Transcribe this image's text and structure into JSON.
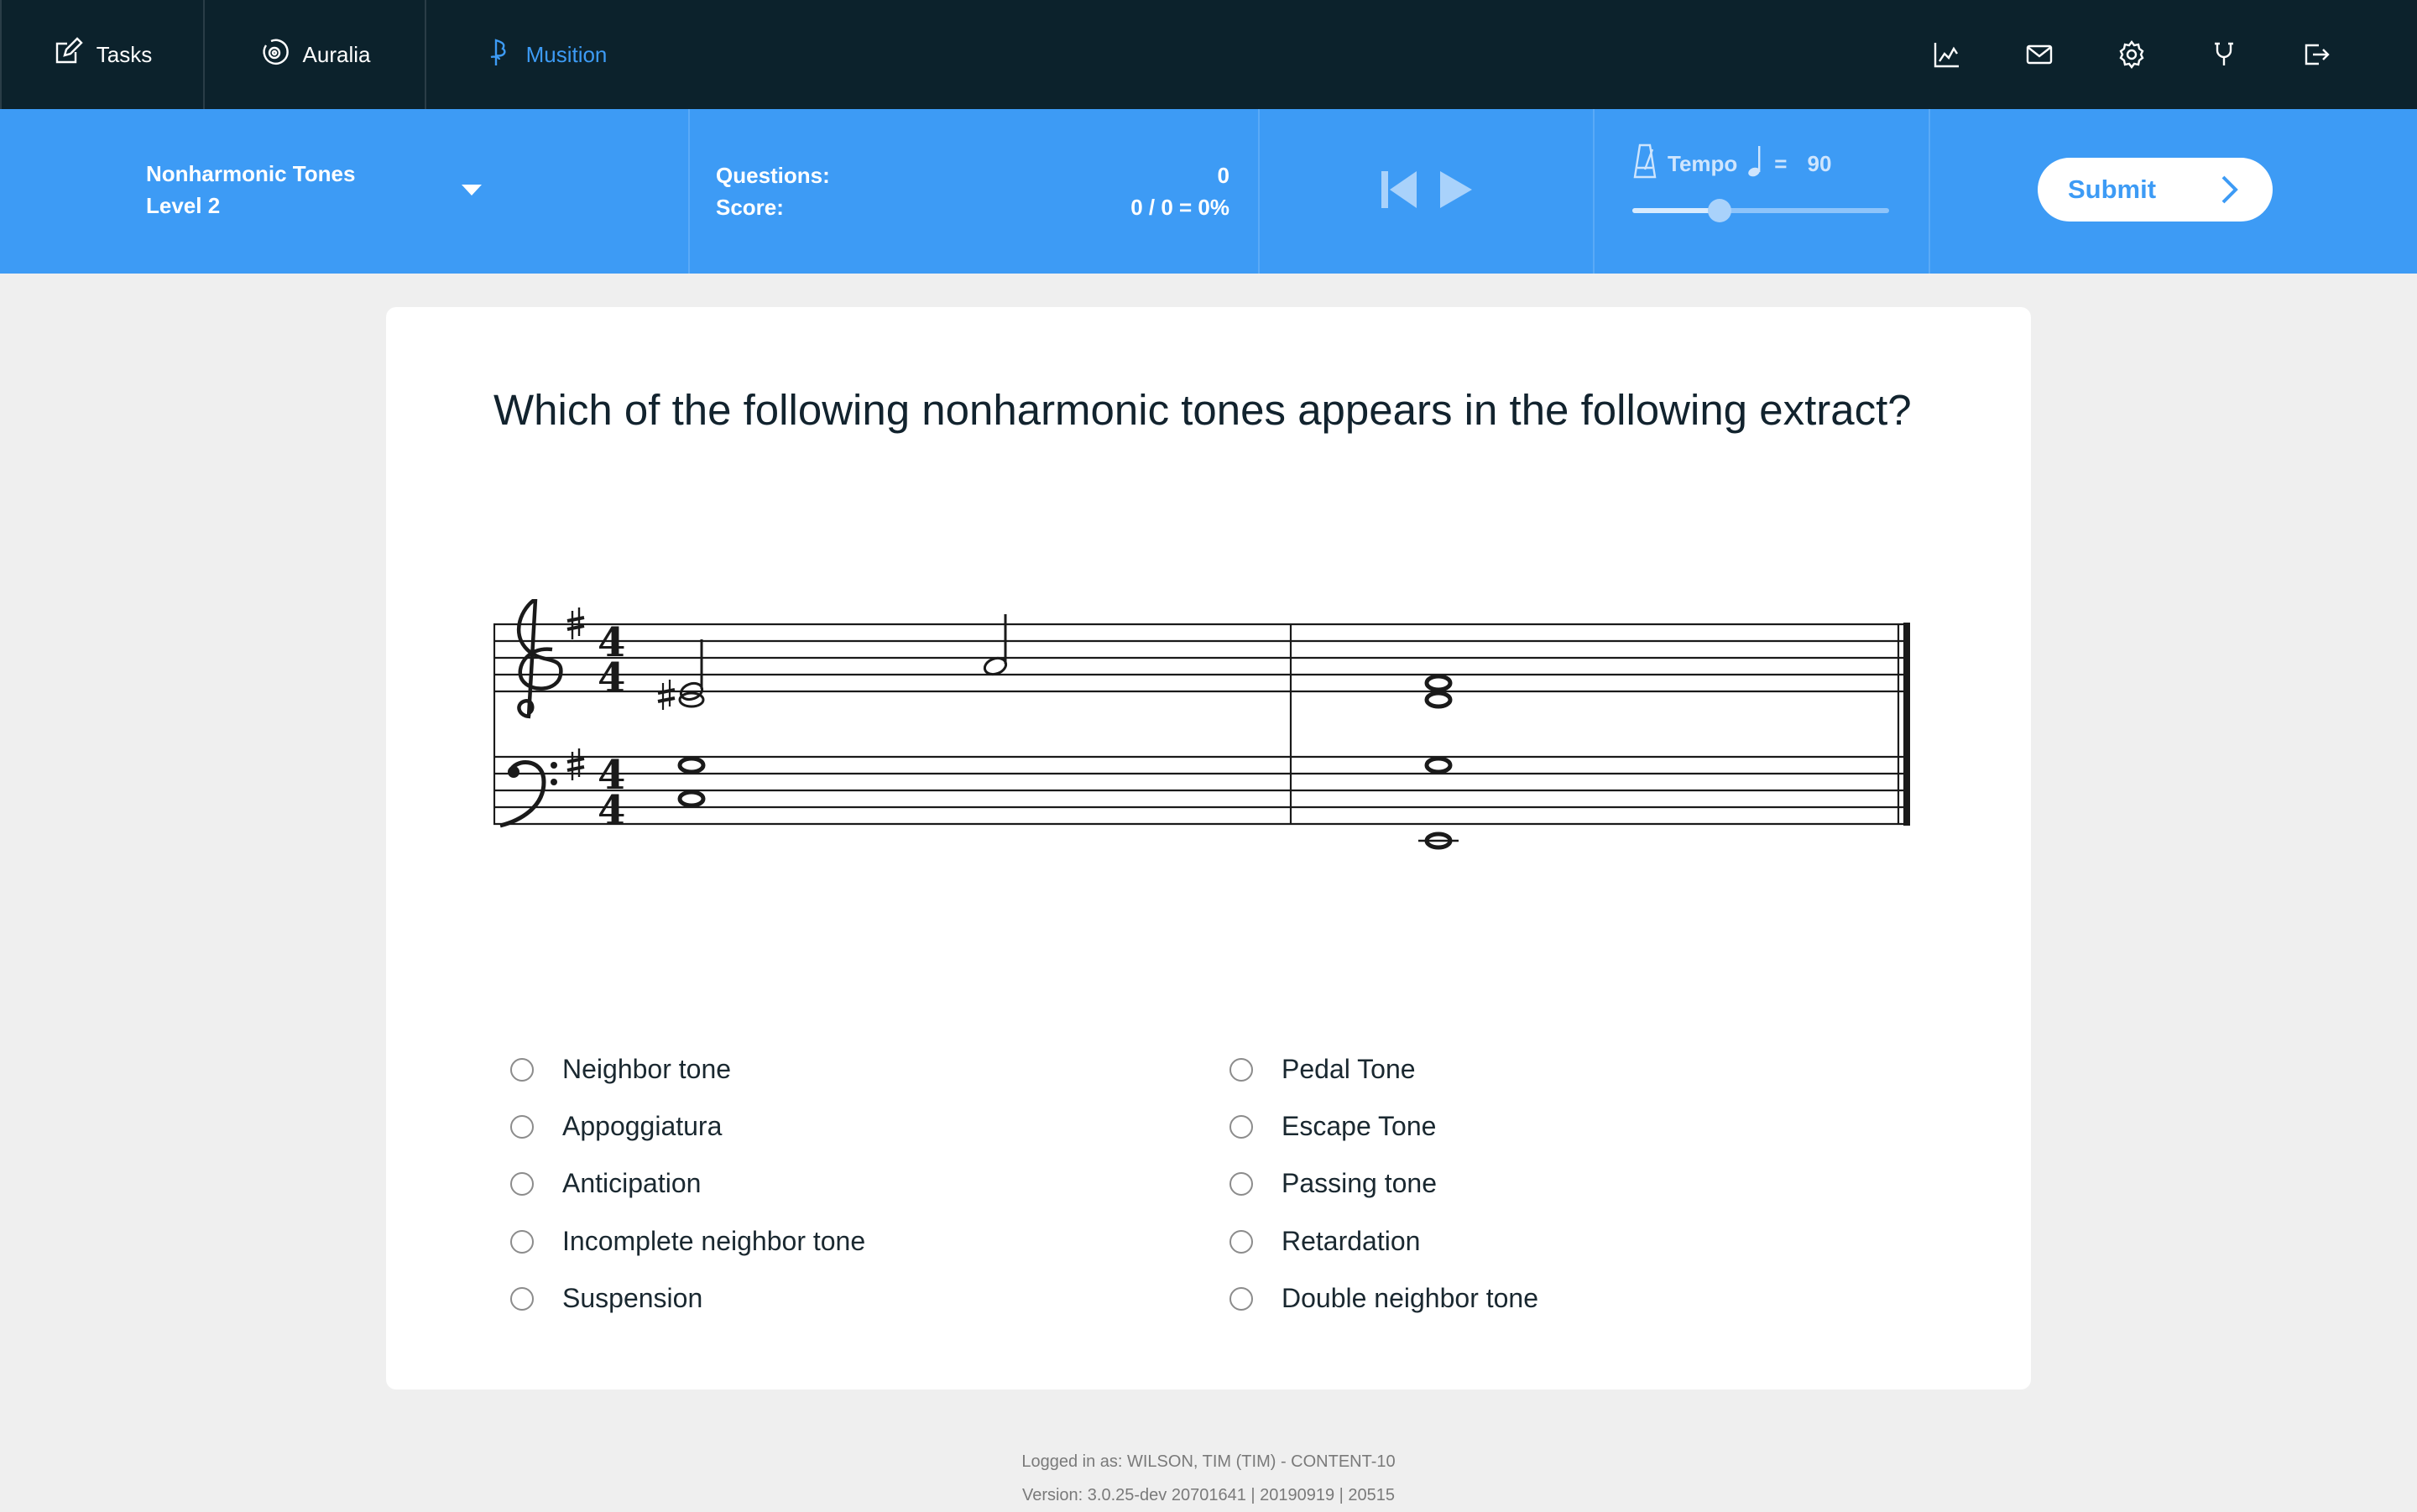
{
  "nav": {
    "tabs": [
      {
        "label": "Tasks",
        "icon": "edit-icon"
      },
      {
        "label": "Auralia",
        "icon": "auralia-icon"
      },
      {
        "label": "Musition",
        "icon": "musition-icon"
      }
    ],
    "active_tab": "Musition",
    "icons": [
      "chart-icon",
      "mail-icon",
      "gear-icon",
      "headphones-icon",
      "logout-icon"
    ]
  },
  "toolbar": {
    "level_title": "Nonharmonic Tones",
    "level_subtitle": "Level 2",
    "questions_label": "Questions:",
    "questions_value": "0",
    "score_label": "Score:",
    "score_value": "0 / 0 = 0%",
    "tempo_label": "Tempo",
    "tempo_equals": "=",
    "tempo_value": "90",
    "tempo_slider_fraction": 0.34,
    "submit_label": "Submit"
  },
  "question": {
    "text": "Which of the following nonharmonic tones appears in the following extract?",
    "key_signature": "G major (one sharp)",
    "time_signature": "4/4"
  },
  "answers": {
    "left": [
      "Neighbor tone",
      "Appoggiatura",
      "Anticipation",
      "Incomplete neighbor tone",
      "Suspension"
    ],
    "right": [
      "Pedal Tone",
      "Escape Tone",
      "Passing tone",
      "Retardation",
      "Double neighbor tone"
    ]
  },
  "footer": {
    "logged_in": "Logged in as: WILSON, TIM (TIM) - CONTENT-10",
    "version": "Version: 3.0.25-dev 20701641 | 20190919 | 20515"
  },
  "colors": {
    "nav_bg": "#0c222c",
    "accent": "#3d9bf5",
    "page_bg": "#efefef"
  }
}
